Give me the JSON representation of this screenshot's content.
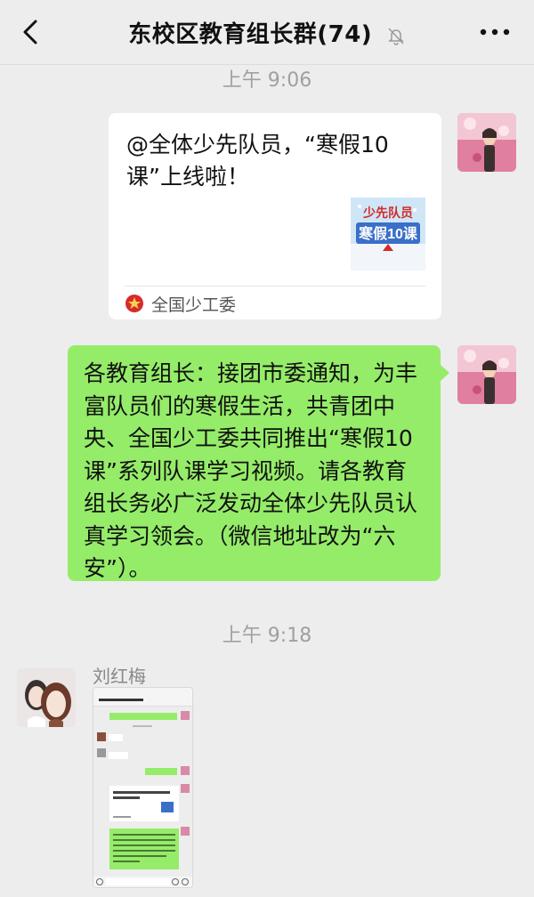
{
  "header": {
    "title": "东校区教育组长群(74)",
    "back_icon": "chevron-left-icon",
    "mute_icon": "bell-muted-icon",
    "more_icon": "more-dots-icon"
  },
  "messages": {
    "time1": "上午 9:06",
    "card": {
      "title": "@全体少先队员，“寒假10课”上线啦！",
      "thumb_text": "少先队员 寒假10课",
      "source": "全国少工委"
    },
    "text_message": "各教育组长：接团市委通知，为丰富队员们的寒假生活，共青团中央、全国少工委共同推出“寒假10课”系列队课学习视频。请各教育组长务必广泛发动全体少先队员认真学习领会。（微信地址改为“六安”）。",
    "time2": "上午 9:18",
    "sender_name": "刘红梅"
  },
  "colors": {
    "background": "#ededed",
    "green_bubble": "#95ec69",
    "white_bubble": "#ffffff"
  }
}
